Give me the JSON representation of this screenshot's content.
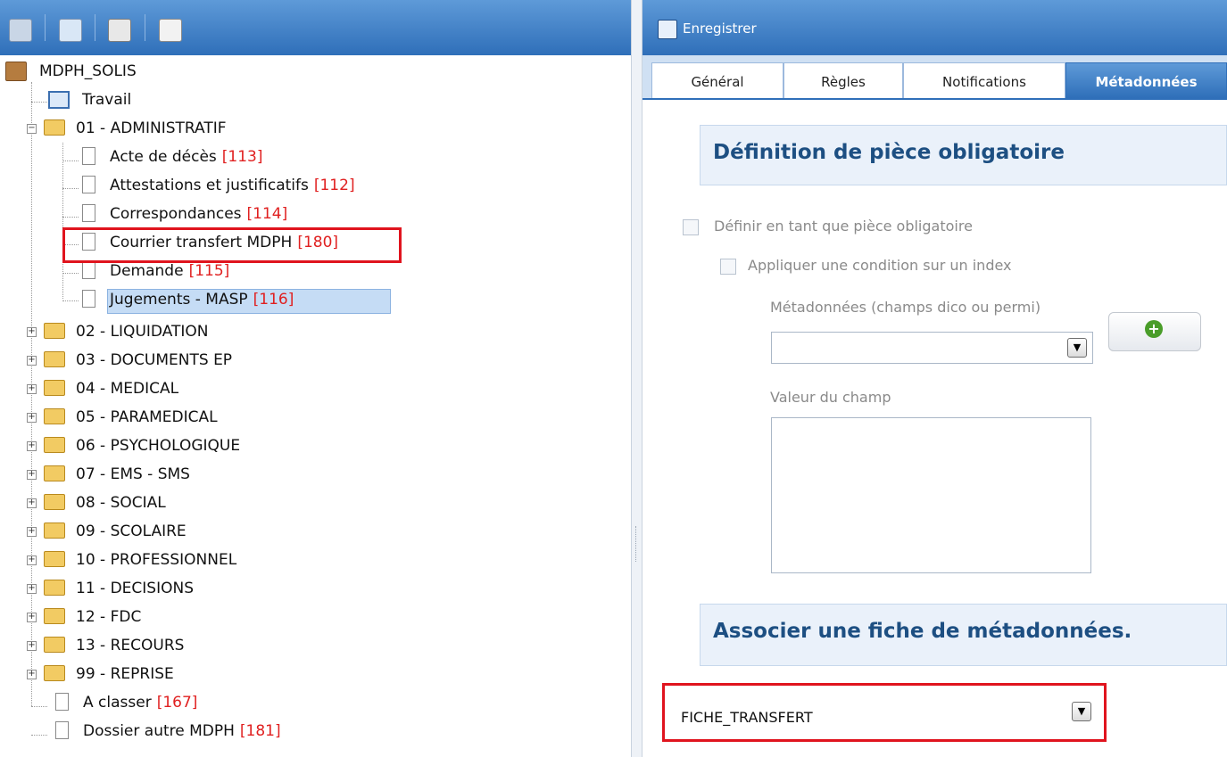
{
  "left_toolbar": {
    "icons": [
      "collapse-all-icon",
      "add-folder-icon",
      "barcode-icon",
      "delete-document-icon"
    ]
  },
  "tree": {
    "root": "MDPH_SOLIS",
    "travail": "Travail",
    "admin": {
      "label": "01 - ADMINISTRATIF",
      "children": [
        {
          "label": "Acte de décès",
          "num": "[113]"
        },
        {
          "label": "Attestations et justificatifs",
          "num": "[112]"
        },
        {
          "label": "Correspondances",
          "num": "[114]"
        },
        {
          "label": "Courrier transfert MDPH",
          "num": "[180]"
        },
        {
          "label": "Demande",
          "num": "[115]"
        },
        {
          "label": "Jugements - MASP",
          "num": "[116]"
        }
      ]
    },
    "folders": [
      "02 - LIQUIDATION",
      "03 - DOCUMENTS EP",
      "04 - MEDICAL",
      "05 - PARAMEDICAL",
      "06 - PSYCHOLOGIQUE",
      "07 - EMS - SMS",
      "08 - SOCIAL",
      "09 - SCOLAIRE",
      "10 - PROFESSIONNEL",
      "11 - DECISIONS",
      "12 - FDC",
      "13 - RECOURS",
      "99 - REPRISE"
    ],
    "docs": [
      {
        "label": "A classer",
        "num": "[167]"
      },
      {
        "label": "Dossier autre MDPH",
        "num": "[181]"
      }
    ]
  },
  "right_toolbar": {
    "save_label": "Enregistrer"
  },
  "tabs": [
    {
      "label": "Général"
    },
    {
      "label": "Règles"
    },
    {
      "label": "Notifications"
    },
    {
      "label": "Métadonnées",
      "active": true
    }
  ],
  "form": {
    "section1_title": "Définition de pièce obligatoire",
    "checkbox1_label": "Définir en tant que pièce obligatoire",
    "checkbox2_label": "Appliquer une condition sur un index",
    "metadata_label": "Métadonnées (champs dico ou permi)",
    "metadata_value": "",
    "value_label": "Valeur du champ",
    "section2_title": "Associer une fiche de métadonnées.",
    "fiche_value": "FICHE_TRANSFERT"
  },
  "colors": {
    "accent": "#2f6fb9",
    "highlight": "#e0141e",
    "count_red": "#e02020"
  }
}
